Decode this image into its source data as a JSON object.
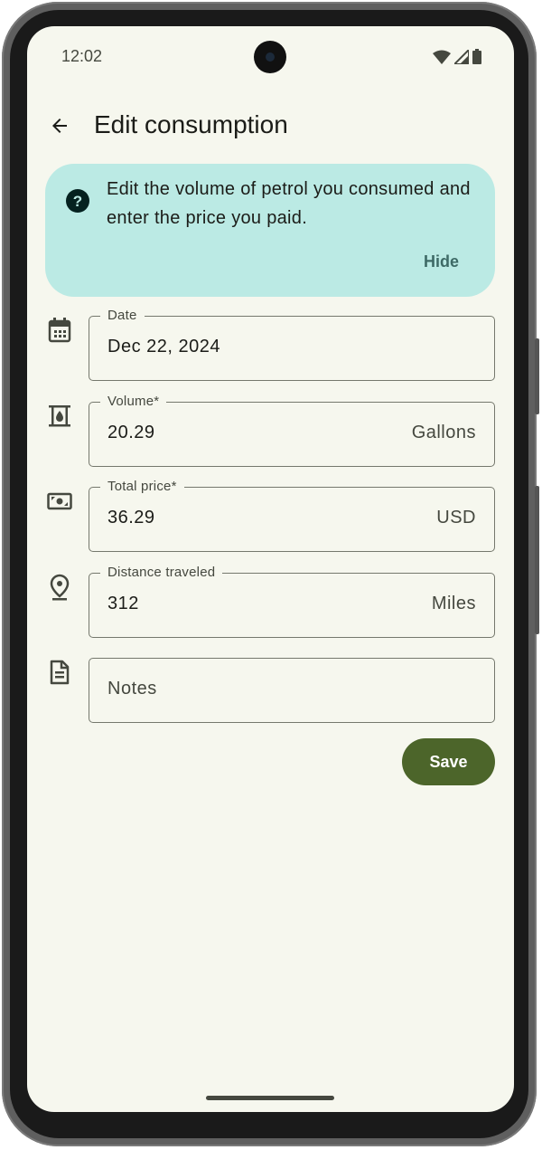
{
  "status_bar": {
    "time": "12:02"
  },
  "app_bar": {
    "title": "Edit consumption",
    "back_icon": "arrow-back-icon"
  },
  "info_card": {
    "icon": "help-circle-icon",
    "text": "Edit the volume of petrol you consumed and enter the price you paid.",
    "hide_label": "Hide"
  },
  "form": {
    "date": {
      "icon": "calendar-icon",
      "label": "Date",
      "value": "Dec 22, 2024"
    },
    "volume": {
      "icon": "fuel-icon",
      "label": "Volume*",
      "value": "20.29",
      "suffix": "Gallons"
    },
    "total_price": {
      "icon": "money-icon",
      "label": "Total price*",
      "value": "36.29",
      "suffix": "USD"
    },
    "distance": {
      "icon": "location-pin-icon",
      "label": "Distance traveled",
      "value": "312",
      "suffix": "Miles"
    },
    "notes": {
      "icon": "document-icon",
      "placeholder": "Notes"
    }
  },
  "save_label": "Save",
  "colors": {
    "background": "#f6f7ee",
    "info_card": "#bbeae4",
    "primary": "#4c652a",
    "outline": "#75786d"
  }
}
